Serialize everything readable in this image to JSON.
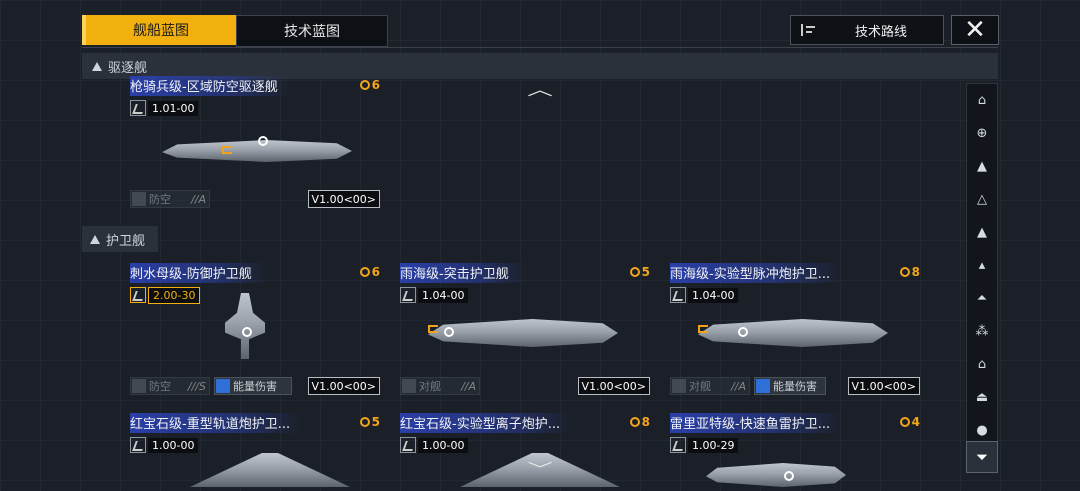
{
  "tabs": [
    {
      "label": "舰船蓝图",
      "active": true
    },
    {
      "label": "技术蓝图",
      "active": false
    }
  ],
  "route_button": {
    "label": "技术路线"
  },
  "close_label": "✕",
  "sections": [
    {
      "title": "驱逐舰"
    },
    {
      "title": "护卫舰"
    }
  ],
  "destroyers": [
    {
      "name": "枪骑兵级-区域防空驱逐舰",
      "cost": "6",
      "version": "1.01-00",
      "role": "防空",
      "role_level": "//A",
      "version_badge": "V1.00<00>"
    }
  ],
  "frigates": [
    {
      "name": "刺水母级-防御护卫舰",
      "cost": "6",
      "version": "2.00-30",
      "role": "防空",
      "role_level": "///S",
      "extra_tag": "能量伤害",
      "version_badge": "V1.00<00>"
    },
    {
      "name": "雨海级-突击护卫舰",
      "cost": "5",
      "version": "1.04-00",
      "role": "对舰",
      "role_level": "//A",
      "version_badge": "V1.00<00>"
    },
    {
      "name": "雨海级-实验型脉冲炮护卫...",
      "cost": "8",
      "version": "1.04-00",
      "role": "对舰",
      "role_level": "//A",
      "extra_tag": "能量伤害",
      "version_badge": "V1.00<00>"
    },
    {
      "name": "红宝石级-重型轨道炮护卫...",
      "cost": "5",
      "version": "1.00-00"
    },
    {
      "name": "红宝石级-实验型离子炮护...",
      "cost": "8",
      "version": "1.00-00"
    },
    {
      "name": "雷里亚特级-快速鱼雷护卫...",
      "cost": "4",
      "version": "1.00-29"
    }
  ],
  "sidebar_icons": [
    "destroyer-class-icon",
    "carrier-class-icon",
    "cruiser-class-icon",
    "frigate-class-icon",
    "corvette-class-icon",
    "fighter-class-icon",
    "support-class-icon",
    "cluster-class-icon",
    "station-class-icon",
    "hangar-class-icon",
    "misc-class-icon"
  ],
  "filter_icon": "filter-icon",
  "colors": {
    "accent": "#f2b00f",
    "cost": "#f3a51b",
    "name_highlight": "#2a3fa8",
    "background": "#1b2028"
  }
}
